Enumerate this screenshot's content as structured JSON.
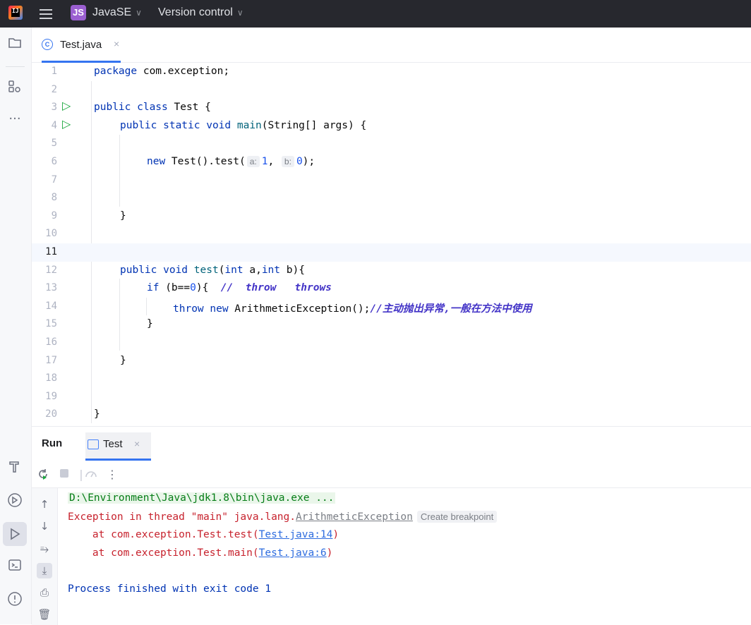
{
  "titlebar": {
    "project_badge": "JS",
    "project_name": "JavaSE",
    "vcs_label": "Version control"
  },
  "editor_tab": {
    "file_name": "Test.java",
    "close": "×"
  },
  "code_lines": [
    {
      "n": "1"
    },
    {
      "n": "2"
    },
    {
      "n": "3"
    },
    {
      "n": "4"
    },
    {
      "n": "5"
    },
    {
      "n": "6"
    },
    {
      "n": "7"
    },
    {
      "n": "8"
    },
    {
      "n": "9"
    },
    {
      "n": "10"
    },
    {
      "n": "11"
    },
    {
      "n": "12"
    },
    {
      "n": "13"
    },
    {
      "n": "14"
    },
    {
      "n": "15"
    },
    {
      "n": "16"
    },
    {
      "n": "17"
    },
    {
      "n": "18"
    },
    {
      "n": "19"
    },
    {
      "n": "20"
    }
  ],
  "code": {
    "l1_kw": "package",
    "l1_rest": " com.exception;",
    "l3_kw": "public class",
    "l3_rest": " Test {",
    "l4_kw": "public static void",
    "l4_fn": " main",
    "l4_rest": "(String[] args) {",
    "l6_kw": "new",
    "l6_rest": " Test().test(",
    "l6_hint_a": "a:",
    "l6_val_a": "1",
    "l6_comma": ",",
    "l6_hint_b": "b:",
    "l6_val_b": "0",
    "l6_end": ");",
    "l9": "}",
    "l12_kw": "public void",
    "l12_fn": " test",
    "l12_p1": "(",
    "l12_int1": "int",
    "l12_a": " a,",
    "l12_int2": "int",
    "l12_b": " b){",
    "l13_kw": "if",
    "l13_cond1": " (b==",
    "l13_zero": "0",
    "l13_cond2": "){  ",
    "l13_comment": "//  throw   throws",
    "l14_kw": "throw new",
    "l14_rest": " ArithmeticException();",
    "l14_comment": "//主动抛出异常,一般在方法中使用",
    "l15": "}",
    "l17": "}",
    "l20": "}"
  },
  "run_panel": {
    "title": "Run",
    "tab_name": "Test",
    "tab_close": "×",
    "output": {
      "cmd": "D:\\Environment\\Java\\jdk1.8\\bin\\java.exe ...",
      "exc_prefix": "Exception in thread \"main\" java.lang.",
      "exc_class": "ArithmeticException",
      "create_breakpoint": "Create breakpoint",
      "trace1_prefix": "    at com.exception.Test.test(",
      "trace1_link": "Test.java:14",
      "trace1_suffix": ")",
      "trace2_prefix": "    at com.exception.Test.main(",
      "trace2_link": "Test.java:6",
      "trace2_suffix": ")",
      "finish": "Process finished with exit code 1"
    }
  },
  "colors": {
    "keyword": "#0033b3",
    "error": "#c7222d",
    "comment": "#4334c7",
    "accent": "#3574f0",
    "run_green": "#1aa73d"
  }
}
